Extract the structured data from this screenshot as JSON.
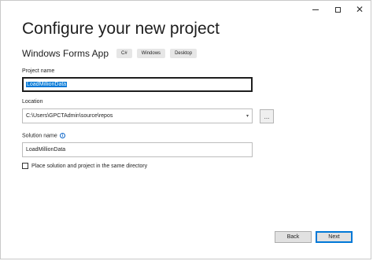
{
  "window": {
    "caption": {
      "minimize_icon": "minimize-icon",
      "maximize_icon": "maximize-icon",
      "close_icon": "close-icon",
      "close_glyph": "✕"
    }
  },
  "header": {
    "title": "Configure your new project",
    "template_name": "Windows Forms App",
    "tags": [
      "C#",
      "Windows",
      "Desktop"
    ]
  },
  "form": {
    "project_name_label": "Project name",
    "project_name_value": "LoadMillionData",
    "location_label": "Location",
    "location_value": "C:\\Users\\GPCTAdmin\\source\\repos",
    "location_dropdown_glyph": "▾",
    "browse_label": "...",
    "solution_name_label": "Solution name",
    "solution_info_glyph": "i",
    "solution_name_value": "LoadMillionData",
    "same_directory_label": "Place solution and project in the same directory",
    "same_directory_checked": false
  },
  "footer": {
    "back_label": "Back",
    "next_label": "Next"
  },
  "colors": {
    "accent": "#0078d7",
    "info": "#0a64c8",
    "tag_bg": "#e6e6e6"
  }
}
